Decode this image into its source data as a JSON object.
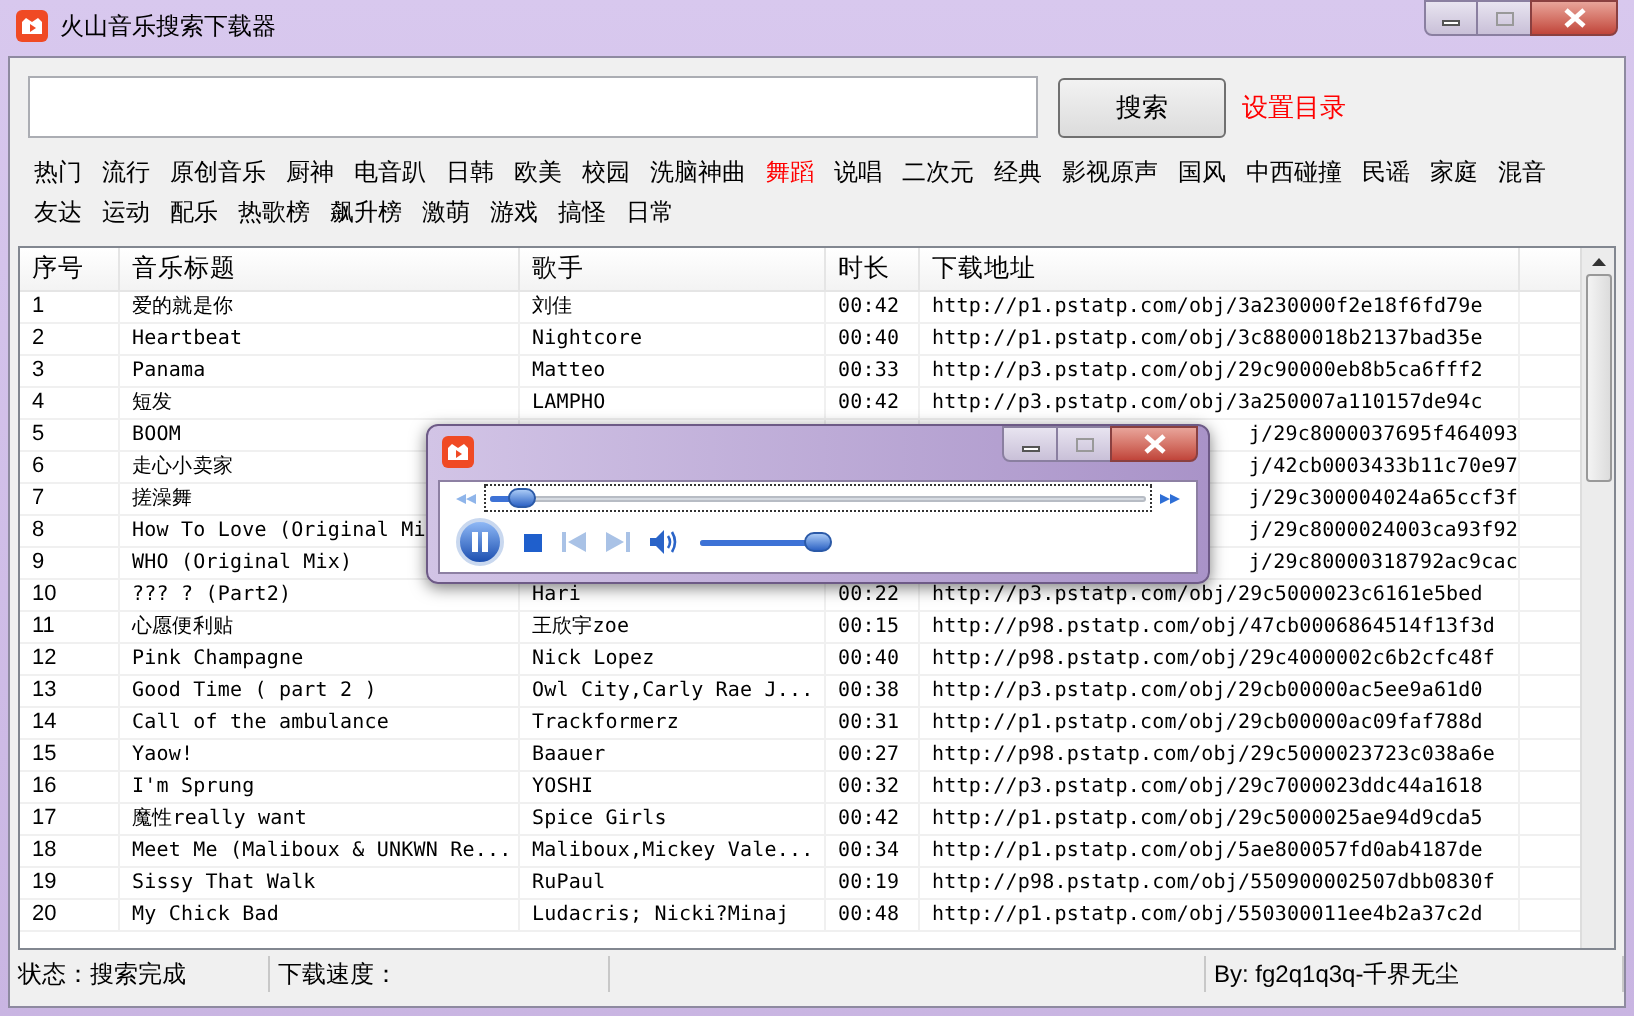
{
  "window": {
    "title": "火山音乐搜索下载器"
  },
  "search": {
    "button": "搜索",
    "link": "设置目录"
  },
  "categories": [
    {
      "label": "热门",
      "selected": false
    },
    {
      "label": "流行",
      "selected": false
    },
    {
      "label": "原创音乐",
      "selected": false
    },
    {
      "label": "厨神",
      "selected": false
    },
    {
      "label": "电音趴",
      "selected": false
    },
    {
      "label": "日韩",
      "selected": false
    },
    {
      "label": "欧美",
      "selected": false
    },
    {
      "label": "校园",
      "selected": false
    },
    {
      "label": "洗脑神曲",
      "selected": false
    },
    {
      "label": "舞蹈",
      "selected": true
    },
    {
      "label": "说唱",
      "selected": false
    },
    {
      "label": "二次元",
      "selected": false
    },
    {
      "label": "经典",
      "selected": false
    },
    {
      "label": "影视原声",
      "selected": false
    },
    {
      "label": "国风",
      "selected": false
    },
    {
      "label": "中西碰撞",
      "selected": false
    },
    {
      "label": "民谣",
      "selected": false
    },
    {
      "label": "家庭",
      "selected": false
    },
    {
      "label": "混音",
      "selected": false
    },
    {
      "label": "友达",
      "selected": false
    },
    {
      "label": "运动",
      "selected": false
    },
    {
      "label": "配乐",
      "selected": false
    },
    {
      "label": "热歌榜",
      "selected": false
    },
    {
      "label": "飙升榜",
      "selected": false
    },
    {
      "label": "激萌",
      "selected": false
    },
    {
      "label": "游戏",
      "selected": false
    },
    {
      "label": "搞怪",
      "selected": false
    },
    {
      "label": "日常",
      "selected": false
    }
  ],
  "table": {
    "columns": [
      "序号",
      "音乐标题",
      "歌手",
      "时长",
      "下载地址"
    ],
    "rows": [
      {
        "no": "1",
        "title": "爱的就是你",
        "artist": "刘佳",
        "duration": "00:42",
        "url": "http://p1.pstatp.com/obj/3a230000f2e18f6fd79e"
      },
      {
        "no": "2",
        "title": "Heartbeat",
        "artist": "Nightcore",
        "duration": "00:40",
        "url": "http://p1.pstatp.com/obj/3c8800018b2137bad35e"
      },
      {
        "no": "3",
        "title": "Panama",
        "artist": "Matteo",
        "duration": "00:33",
        "url": "http://p3.pstatp.com/obj/29c90000eb8b5ca6fff2"
      },
      {
        "no": "4",
        "title": "短发",
        "artist": "LAMPHO",
        "duration": "00:42",
        "url": "http://p3.pstatp.com/obj/3a250007a110157de94c"
      },
      {
        "no": "5",
        "title": "BOOM",
        "url": "j/29c8000037695f464093"
      },
      {
        "no": "6",
        "title": "走心小卖家",
        "url": "j/42cb0003433b11c70e97"
      },
      {
        "no": "7",
        "title": "搓澡舞",
        "url": "j/29c300004024a65ccf3f"
      },
      {
        "no": "8",
        "title": "How To Love (Original Mi",
        "url": "j/29c8000024003ca93f92"
      },
      {
        "no": "9",
        "title": "WHO (Original Mix)",
        "url": "j/29c80000318792ac9cac"
      },
      {
        "no": "10",
        "title": "??? ? (Part2)",
        "artist": "Hari",
        "duration": "00:22",
        "url": "http://p3.pstatp.com/obj/29c5000023c6161e5bed"
      },
      {
        "no": "11",
        "title": "心愿便利贴",
        "artist": "王欣宇zoe",
        "duration": "00:15",
        "url": "http://p98.pstatp.com/obj/47cb0006864514f13f3d"
      },
      {
        "no": "12",
        "title": "Pink Champagne",
        "artist": "Nick Lopez",
        "duration": "00:40",
        "url": "http://p98.pstatp.com/obj/29c4000002c6b2cfc48f"
      },
      {
        "no": "13",
        "title": "Good Time ( part 2 )",
        "artist": "Owl City,Carly Rae J...",
        "duration": "00:38",
        "url": "http://p3.pstatp.com/obj/29cb00000ac5ee9a61d0"
      },
      {
        "no": "14",
        "title": "Call of the ambulance",
        "artist": "Trackformerz",
        "duration": "00:31",
        "url": "http://p1.pstatp.com/obj/29cb00000ac09faf788d"
      },
      {
        "no": "15",
        "title": "Yaow!",
        "artist": "Baauer",
        "duration": "00:27",
        "url": "http://p98.pstatp.com/obj/29c5000023723c038a6e"
      },
      {
        "no": "16",
        "title": "I'm Sprung",
        "artist": "YOSHI",
        "duration": "00:32",
        "url": "http://p3.pstatp.com/obj/29c7000023ddc44a1618"
      },
      {
        "no": "17",
        "title": "魔性really want",
        "artist": "Spice Girls",
        "duration": "00:42",
        "url": "http://p1.pstatp.com/obj/29c5000025ae94d9cda5"
      },
      {
        "no": "18",
        "title": "Meet Me (Maliboux & UNKWN Re...",
        "artist": "Maliboux,Mickey Vale...",
        "duration": "00:34",
        "url": "http://p1.pstatp.com/obj/5ae800057fd0ab4187de"
      },
      {
        "no": "19",
        "title": "Sissy That Walk",
        "artist": "RuPaul",
        "duration": "00:19",
        "url": "http://p98.pstatp.com/obj/550900002507dbb0830f"
      },
      {
        "no": "20",
        "title": "My Chick Bad",
        "artist": "Ludacris; Nicki?Minaj",
        "duration": "00:48",
        "url": "http://p1.pstatp.com/obj/550300011ee4b2a37c2d"
      }
    ]
  },
  "player": {
    "playing": true,
    "seek": {
      "level": 0.05
    },
    "volume": {
      "level": 0.9
    }
  },
  "status_bar": [
    "状态：搜索完成",
    "下载速度：",
    "By: fg2q1q3q-千界无尘"
  ]
}
